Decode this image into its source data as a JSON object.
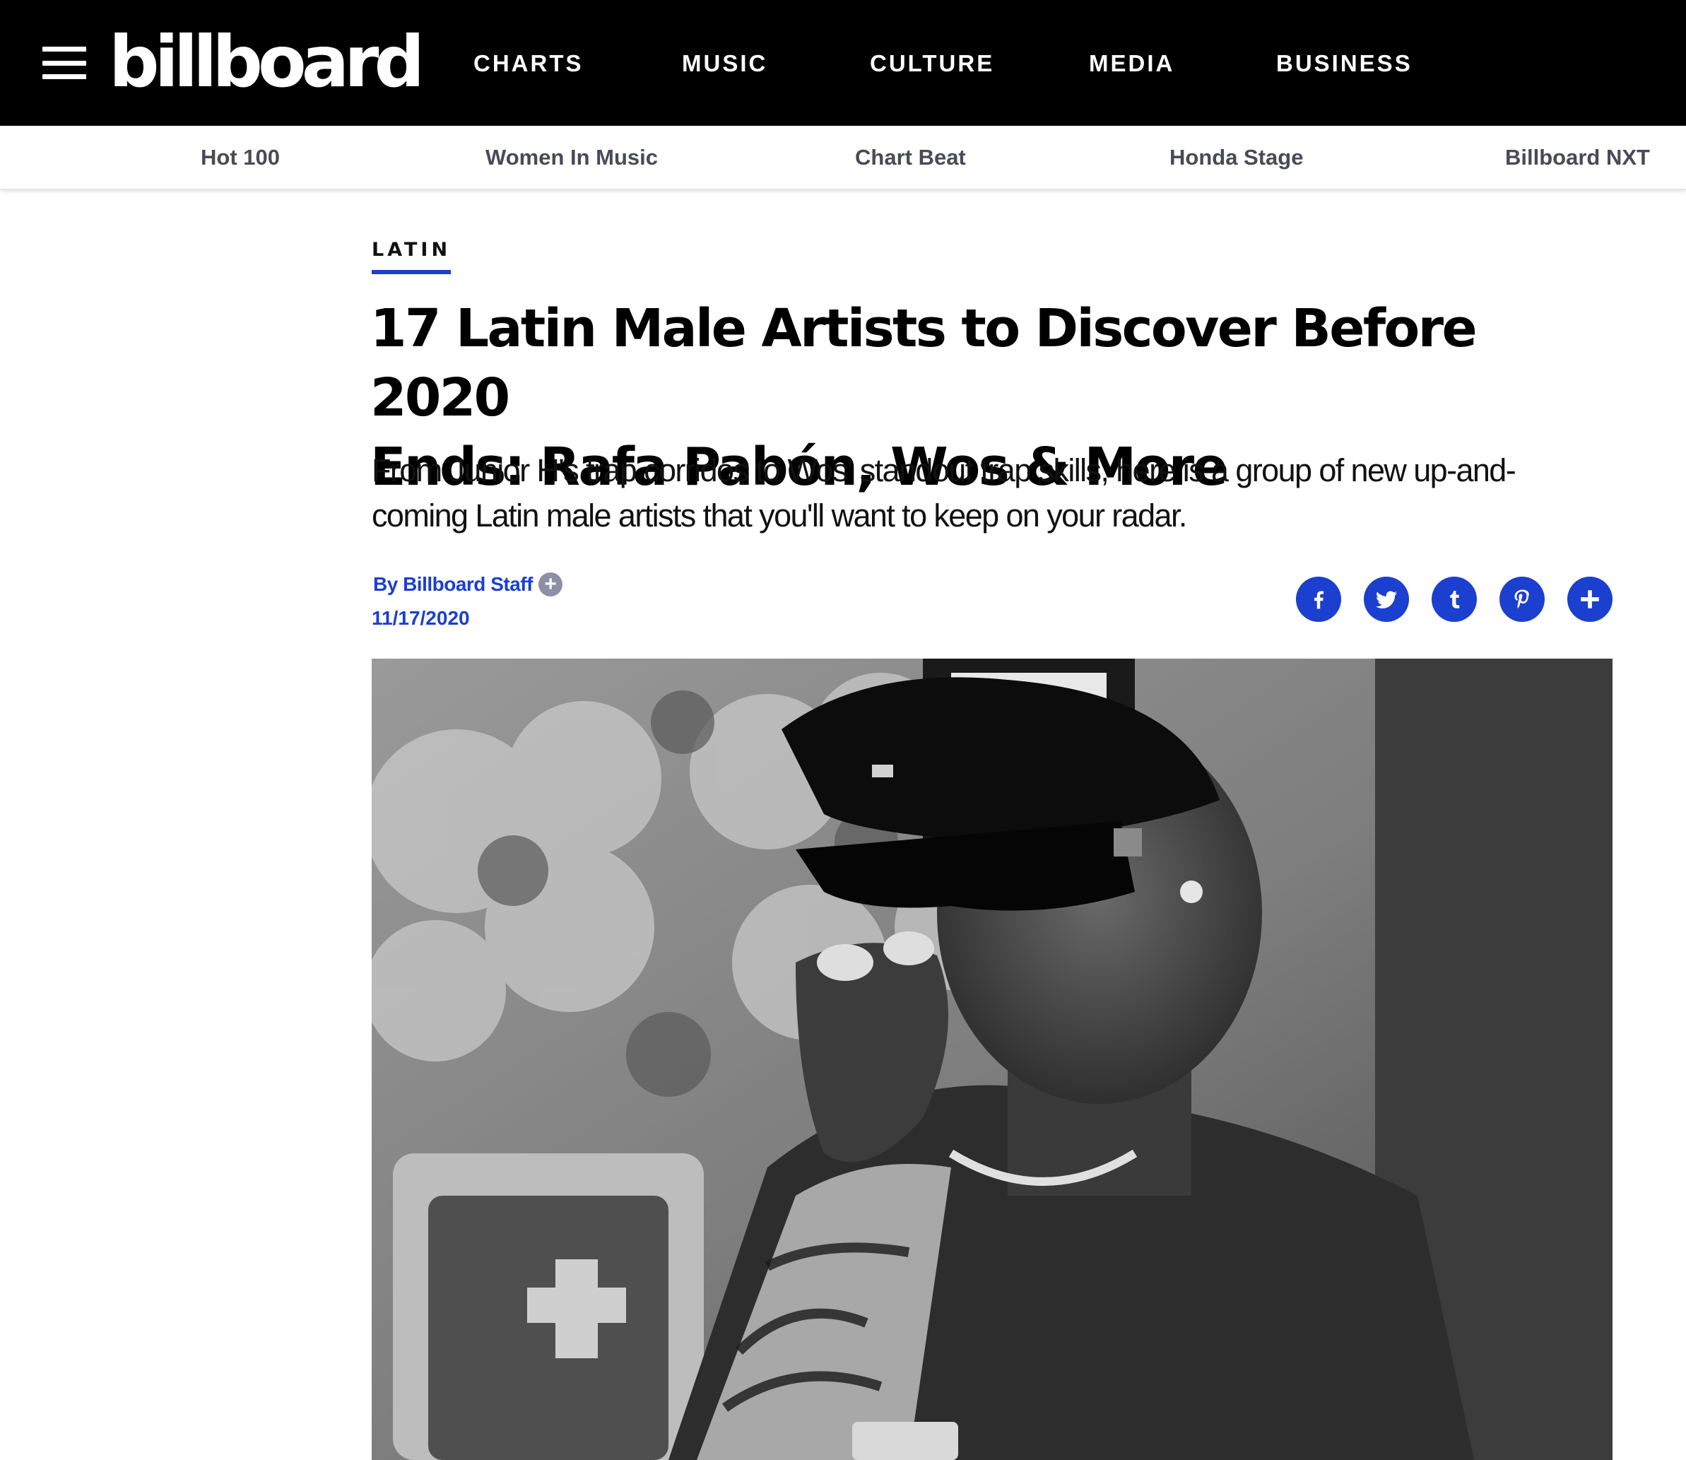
{
  "header": {
    "logo_text": "billboard",
    "nav": [
      "CHARTS",
      "MUSIC",
      "CULTURE",
      "MEDIA",
      "BUSINESS"
    ]
  },
  "subnav": [
    "Hot 100",
    "Women In Music",
    "Chart Beat",
    "Honda Stage",
    "Billboard NXT"
  ],
  "article": {
    "category": "LATIN",
    "headline_line1": "17 Latin Male Artists to Discover Before 2020",
    "headline_line2": "Ends: Rafa Pabón, Wos & More",
    "dek_line1": "From Junior H's trap corridos to Wos' standout trap skills, here is a group of new up-and-",
    "dek_line2": "coming Latin male artists that you'll want to keep on your radar.",
    "byline": "By Billboard Staff",
    "byline_more": "+",
    "date": "11/17/2020"
  },
  "share": [
    "facebook-icon",
    "twitter-icon",
    "tumblr-icon",
    "pinterest-icon",
    "plus-icon"
  ],
  "colors": {
    "accent": "#1b3fcf",
    "header_bg": "#000000",
    "subnav_text": "#4a4a57"
  }
}
